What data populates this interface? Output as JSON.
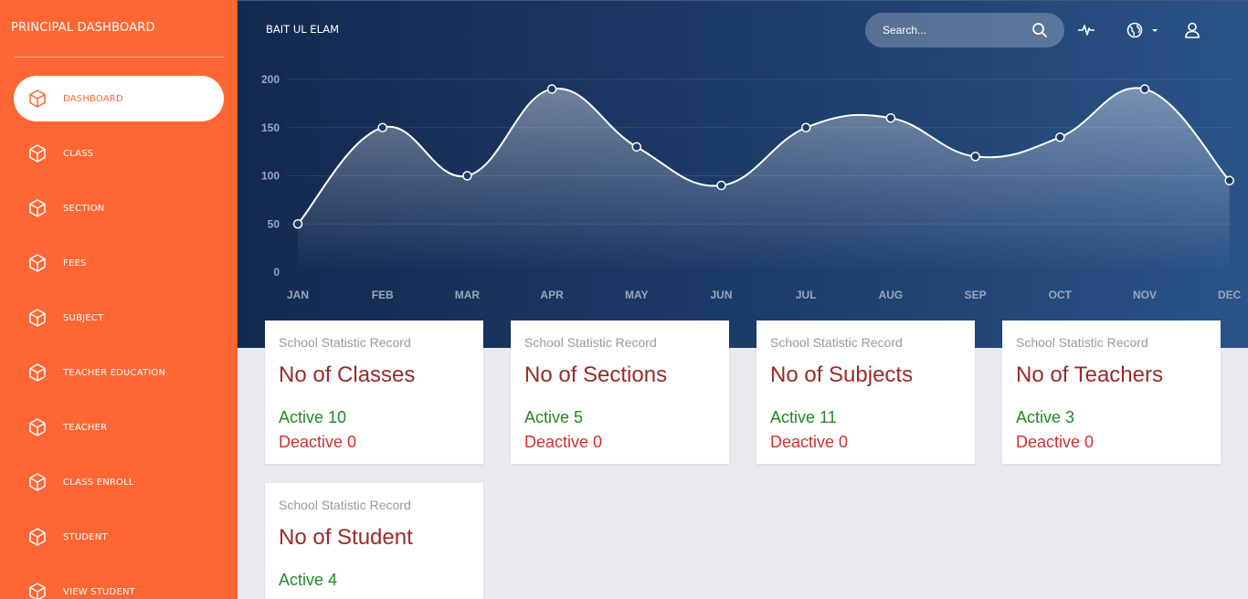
{
  "sidebar": {
    "title": "PRINCIPAL DASHBOARD",
    "items": [
      {
        "label": "DASHBOARD",
        "icon": "cube-icon",
        "active": true
      },
      {
        "label": "CLASS",
        "icon": "cube-icon"
      },
      {
        "label": "SECTION",
        "icon": "cube-icon"
      },
      {
        "label": "FEES",
        "icon": "cube-icon"
      },
      {
        "label": "SUBJECT",
        "icon": "cube-icon"
      },
      {
        "label": "TEACHER EDUCATION",
        "icon": "cube-icon"
      },
      {
        "label": "TEACHER",
        "icon": "cube-icon"
      },
      {
        "label": "CLASS ENROLL",
        "icon": "cube-icon"
      },
      {
        "label": "STUDENT",
        "icon": "cube-icon"
      },
      {
        "label": "VIEW STUDENT",
        "icon": "cube-icon"
      }
    ]
  },
  "header": {
    "brand": "BAIT UL ELAM",
    "search_placeholder": "Search...",
    "icons": [
      "search-icon",
      "activity-icon",
      "globe-icon",
      "user-icon"
    ]
  },
  "colors": {
    "sidebar": "#ff6633",
    "hero_start": "#13294f",
    "hero_end": "#2a5388",
    "card_title": "#9b2a2a",
    "active": "#1f8a1f",
    "deactive": "#d32f2f"
  },
  "chart_data": {
    "type": "line",
    "categories": [
      "JAN",
      "FEB",
      "MAR",
      "APR",
      "MAY",
      "JUN",
      "JUL",
      "AUG",
      "SEP",
      "OCT",
      "NOV",
      "DEC"
    ],
    "series": [
      {
        "values": [
          50,
          150,
          100,
          190,
          130,
          90,
          150,
          160,
          120,
          140,
          190,
          95
        ]
      }
    ],
    "yticks": [
      0,
      50,
      100,
      150,
      200
    ],
    "ylim": [
      0,
      200
    ],
    "grid": true,
    "smooth": true,
    "fill": true
  },
  "cards": [
    {
      "subtitle": "School Statistic Record",
      "title": "No of Classes",
      "active": "Active 10",
      "deactive": "Deactive 0"
    },
    {
      "subtitle": "School Statistic Record",
      "title": "No of Sections",
      "active": "Active 5",
      "deactive": "Deactive 0"
    },
    {
      "subtitle": "School Statistic Record",
      "title": "No of Subjects",
      "active": "Active 11",
      "deactive": "Deactive 0"
    },
    {
      "subtitle": "School Statistic Record",
      "title": "No of Teachers",
      "active": "Active 3",
      "deactive": "Deactive 0"
    },
    {
      "subtitle": "School Statistic Record",
      "title": "No of Student",
      "active": "Active 4",
      "deactive": ""
    }
  ]
}
